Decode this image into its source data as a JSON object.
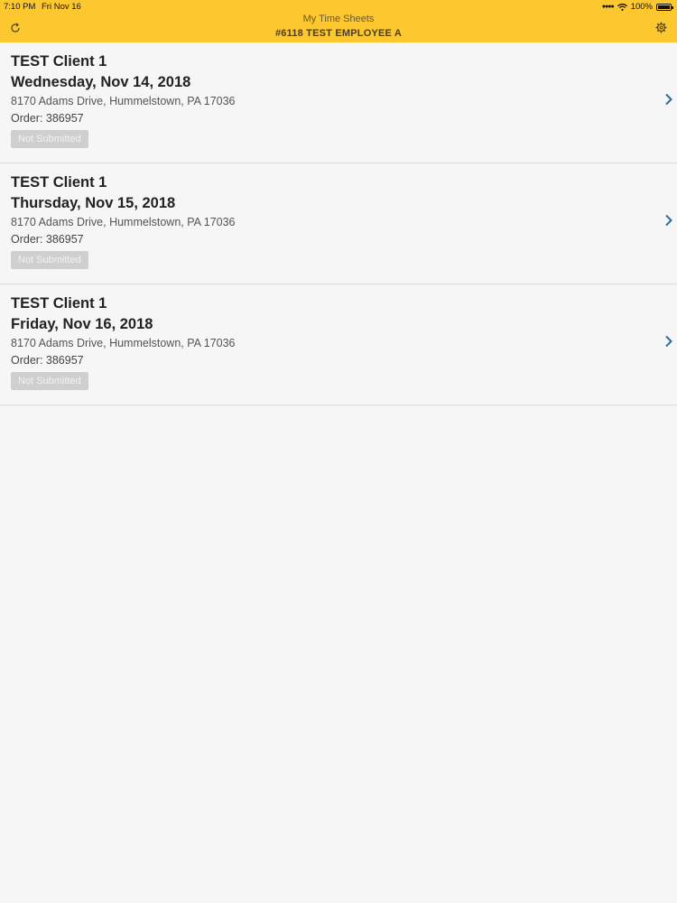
{
  "status_bar": {
    "time": "7:10 PM",
    "date": "Fri Nov 16",
    "battery": "100%"
  },
  "nav": {
    "title": "My Time Sheets",
    "subtitle": "#6118 TEST EMPLOYEE A",
    "left_icon": "refresh-icon",
    "right_icon": "gear-icon",
    "bar_color": "#fdc72f"
  },
  "timesheets": [
    {
      "client": "TEST Client 1",
      "date": "Wednesday, Nov 14, 2018",
      "address": "8170 Adams Drive, Hummelstown, PA 17036",
      "order": "Order: 386957",
      "status": "Not Submitted"
    },
    {
      "client": "TEST Client 1",
      "date": "Thursday, Nov 15, 2018",
      "address": "8170 Adams Drive, Hummelstown, PA 17036",
      "order": "Order: 386957",
      "status": "Not Submitted"
    },
    {
      "client": "TEST Client 1",
      "date": "Friday, Nov 16, 2018",
      "address": "8170 Adams Drive, Hummelstown, PA 17036",
      "order": "Order: 386957",
      "status": "Not Submitted"
    }
  ],
  "colors": {
    "accent": "#fdc72f",
    "chevron": "#2a6f9a",
    "badge_bg": "#cfcfcf"
  }
}
